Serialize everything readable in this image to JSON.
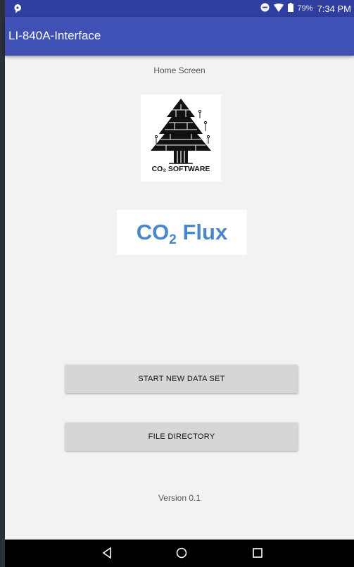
{
  "status_bar": {
    "battery_percent": "79%",
    "time": "7:34 PM",
    "icons": [
      "notification-icon",
      "do-not-disturb-icon",
      "wifi-icon",
      "battery-icon"
    ]
  },
  "app_bar": {
    "title": "LI-840A-Interface",
    "color": "#3f51b5"
  },
  "main": {
    "screen_label": "Home Screen",
    "logo": {
      "text": "CO₂ SOFTWARE",
      "icon": "tree-icon"
    },
    "app_name": {
      "prefix": "CO",
      "subscript": "2",
      "suffix": " Flux",
      "color": "#4a86c8"
    },
    "buttons": {
      "start_new": "START NEW DATA SET",
      "file_directory": "FILE DIRECTORY"
    },
    "version": "Version 0.1"
  },
  "nav_bar": {
    "icons": [
      "back-icon",
      "home-icon",
      "recents-icon"
    ]
  }
}
